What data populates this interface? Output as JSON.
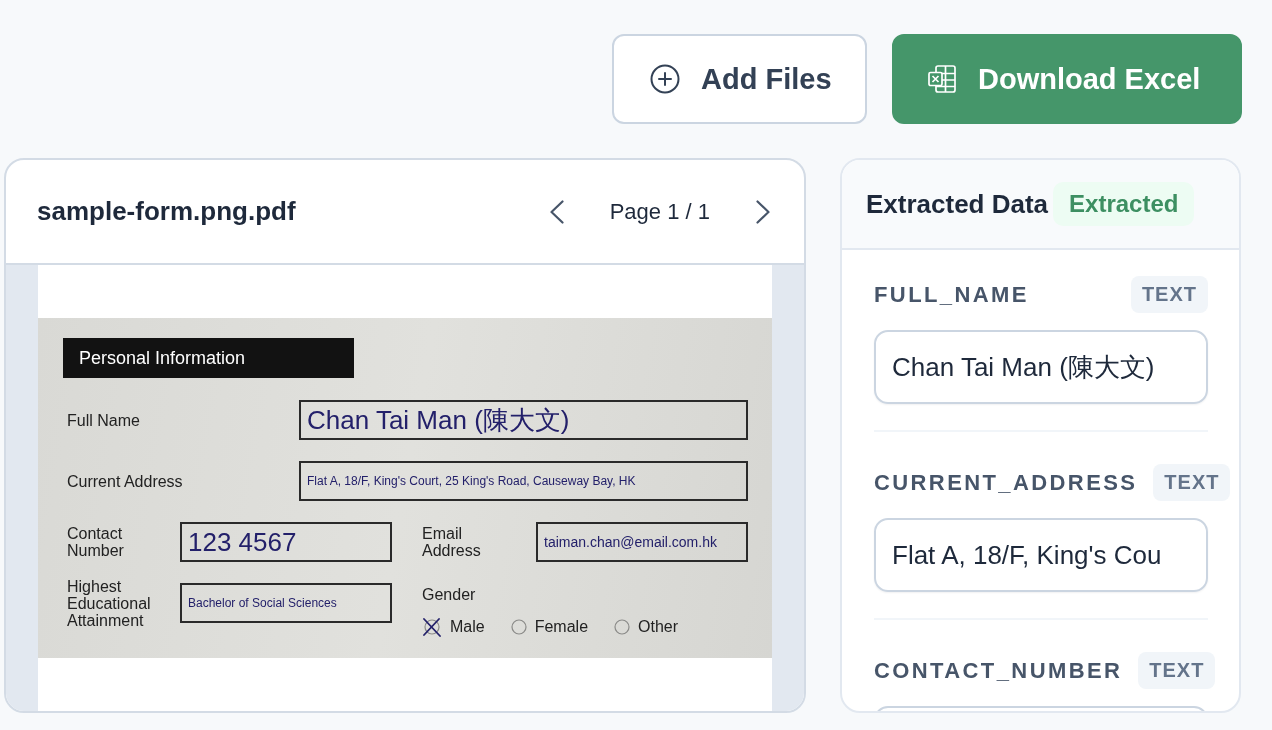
{
  "toolbar": {
    "buttons": [
      {
        "kind": "secondary",
        "label": "Add Files"
      },
      {
        "kind": "primary",
        "label": "Download Excel"
      }
    ]
  },
  "viewer": {
    "file_name": "sample-form.png.pdf",
    "page_label": "Page 1 / 1",
    "document": {
      "section_title": "Personal Information",
      "fields": [
        {
          "kind": "wide",
          "label": "Full Name",
          "value": "Chan Tai Man (陳大文)"
        },
        {
          "kind": "wide",
          "label": "Current Address",
          "value": "Flat A, 18/F, King's Court, 25 King's Road, Causeway Bay, HK"
        },
        {
          "kind": "half",
          "label": "Contact Number",
          "value": "123 4567"
        },
        {
          "kind": "half",
          "label": "Email Address",
          "value": "taiman.chan@email.com.hk"
        },
        {
          "kind": "half",
          "label": "Highest Educational Attainment",
          "value": "Bachelor of Social Sciences"
        }
      ],
      "gender": {
        "label": "Gender",
        "options": [
          {
            "label": "Male",
            "selected": true
          },
          {
            "label": "Female",
            "selected": false
          },
          {
            "label": "Other",
            "selected": false
          }
        ]
      }
    }
  },
  "extracted": {
    "title": "Extracted Data",
    "status": "Extracted",
    "fields": [
      {
        "key": "FULL_NAME",
        "type": "TEXT",
        "value": "Chan Tai Man (陳大文)"
      },
      {
        "key": "CURRENT_ADDRESS",
        "type": "TEXT",
        "value": "Flat A, 18/F, King's Cou"
      },
      {
        "key": "CONTACT_NUMBER",
        "type": "TEXT"
      }
    ]
  }
}
